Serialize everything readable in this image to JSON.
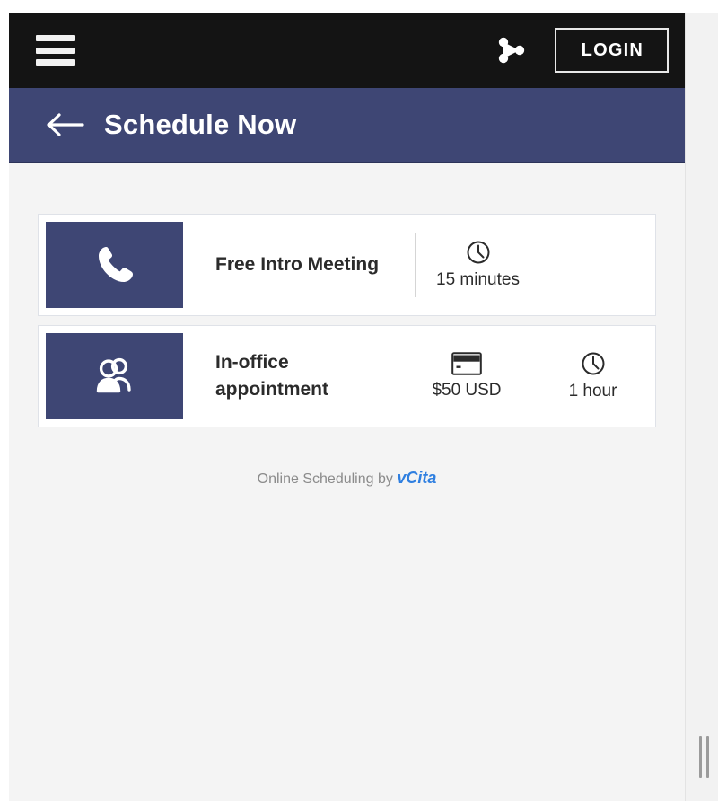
{
  "colors": {
    "topbar_bg": "#141414",
    "header_blue": "#3e4674",
    "page_bg": "#f4f4f4",
    "card_bg": "#ffffff",
    "brand_link": "#2f7fe0",
    "muted_text": "#8b8b8b"
  },
  "topbar": {
    "menu_icon": "hamburger-menu-icon",
    "share_icon": "share-icon",
    "login_label": "LOGIN"
  },
  "header": {
    "back_icon": "arrow-left-icon",
    "title": "Schedule Now"
  },
  "services": [
    {
      "icon": "phone-icon",
      "title": "Free Intro Meeting",
      "price": null,
      "price_icon": null,
      "duration": "15 minutes",
      "duration_icon": "clock-icon"
    },
    {
      "icon": "people-icon",
      "title": "In-office appointment",
      "price": "$50 USD",
      "price_icon": "credit-card-icon",
      "duration": "1 hour",
      "duration_icon": "clock-icon"
    }
  ],
  "footer": {
    "text": "Online Scheduling by",
    "brand": "vCita"
  },
  "window": {
    "resize_handle": "resize-handle-icon"
  }
}
